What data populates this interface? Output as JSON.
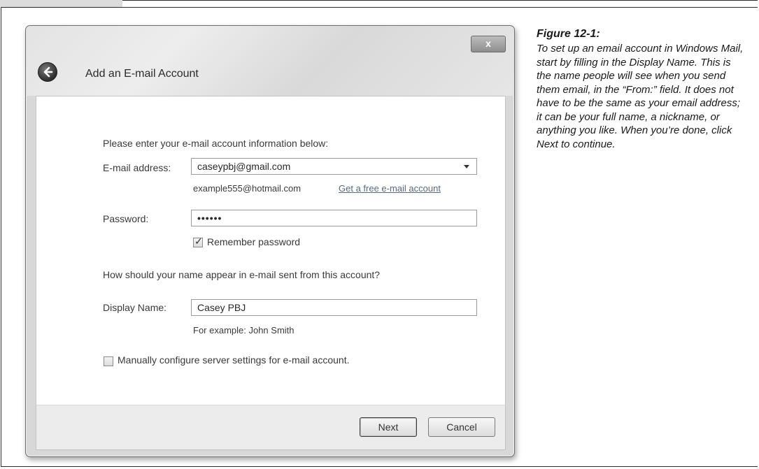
{
  "window": {
    "close_glyph": "x",
    "title": "Add an E-mail Account"
  },
  "form": {
    "intro": "Please enter your e-mail account information below:",
    "email_label": "E-mail address:",
    "email_value": "caseypbj@gmail.com",
    "email_example": "example555@hotmail.com",
    "free_account_link": "Get a free e-mail account",
    "password_label": "Password:",
    "password_value": "••••••",
    "remember_label": "Remember password",
    "remember_checked": true,
    "name_question": "How should your name appear in e-mail sent from this account?",
    "display_name_label": "Display Name:",
    "display_name_value": "Casey PBJ",
    "display_name_example": "For example: John Smith",
    "manual_config_label": "Manually configure server settings for e-mail account.",
    "manual_config_checked": false
  },
  "buttons": {
    "next": "Next",
    "cancel": "Cancel"
  },
  "caption": {
    "title": "Figure 12-1:",
    "body": "To set up an email account in Windows Mail, start by filling in the Display Name. This is the name people will see when you send them email, in the “From:” field. It does not have to be the same as your email address; it can be your full name, a nickname, or anything you like. When you’re done, click Next to continue."
  }
}
